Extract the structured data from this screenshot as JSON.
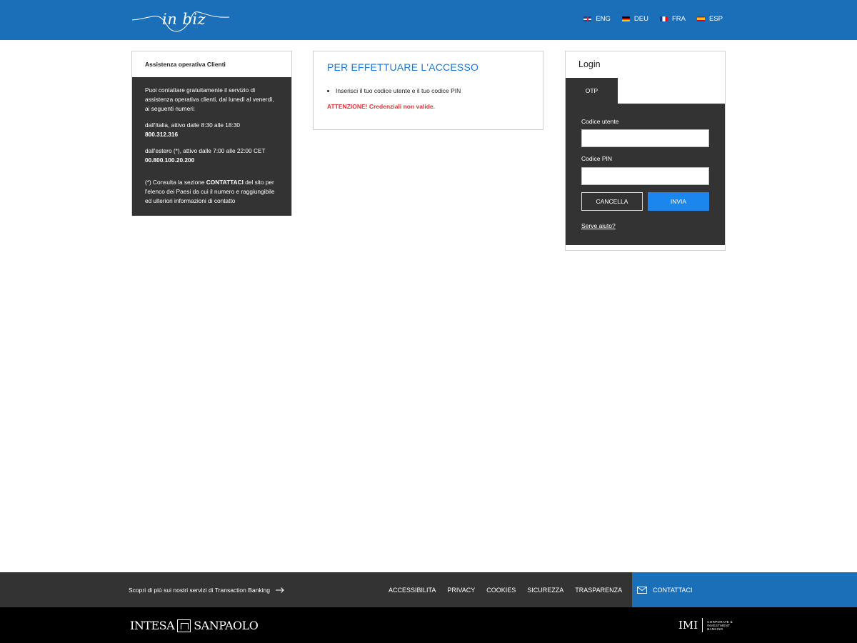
{
  "header": {
    "logo_text": "in biz",
    "languages": [
      {
        "code": "ENG",
        "flag": "uk"
      },
      {
        "code": "DEU",
        "flag": "de"
      },
      {
        "code": "FRA",
        "flag": "fr"
      },
      {
        "code": "ESP",
        "flag": "es"
      }
    ]
  },
  "assistance": {
    "title": "Assistenza operativa Clienti",
    "intro": "Puoi contattare gratuitamente il servizio di assistenza operativa clienti, dal lunedì al venerdì, ai seguenti numeri:",
    "italy_label": "dall'Italia, attivo dalle 8:30 alle 18:30",
    "italy_number": "800.312.316",
    "abroad_label": "dall'estero (*), attivo dalle 7:00 alle 22:00 CET",
    "abroad_number": "00.800.100.20.200",
    "note_prefix": "(*) Consulta la sezione",
    "note_bold": "CONTATTACI",
    "note_suffix": "del sito per l'elenco dei Paesi da cui il numero e raggiungibile ed ulteriori informazioni di contatto"
  },
  "access": {
    "title": "PER EFFETTUARE L'ACCESSO",
    "instruction": "Inserisci il tuo codice utente e il tuo codice PIN",
    "error": "ATTENZIONE! Credenziali non valide."
  },
  "login": {
    "title": "Login",
    "tab": "OTP",
    "user_label": "Codice utente",
    "user_value": "",
    "pin_label": "Codice PIN",
    "pin_value": "",
    "cancel": "CANCELLA",
    "submit": "INVIA",
    "help": "Serve aiuto?"
  },
  "footer": {
    "discover": "Scopri di più sui nostri servizi di Transaction Banking",
    "links": [
      "ACCESSIBILITA",
      "PRIVACY",
      "COOKIES",
      "SICUREZZA",
      "TRASPARENZA"
    ],
    "contact": "CONTATTACI"
  },
  "brand": {
    "left_a": "INTESA",
    "left_b": "SANPAOLO",
    "right": "IMI",
    "right_sub_1": "CORPORATE &",
    "right_sub_2": "INVESTMENT",
    "right_sub_3": "BANKING"
  },
  "colors": {
    "header_blue": "#1a6fb8",
    "title_blue": "#1a7ad8",
    "error_red": "#d83535",
    "dark_panel": "#333333"
  }
}
